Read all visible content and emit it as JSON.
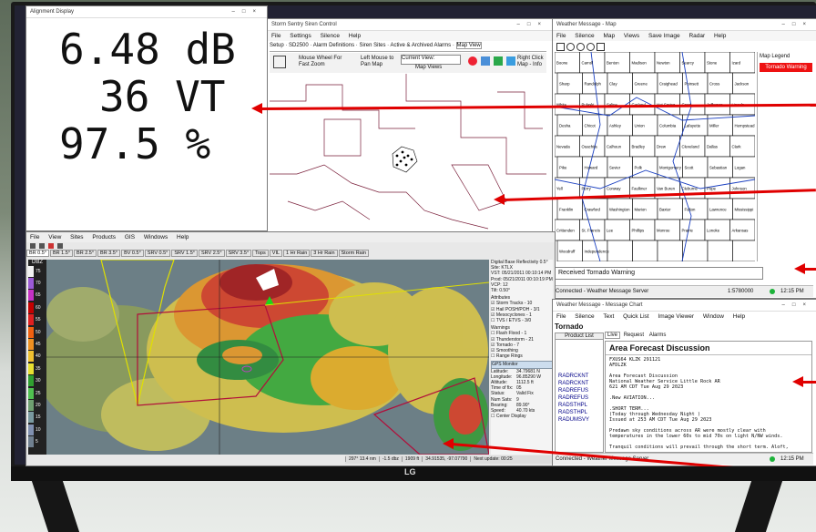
{
  "alignment": {
    "title": "Alignment Display",
    "line1": "6.48 dB",
    "line2": "36 VT",
    "line3": "97.5 %"
  },
  "siren": {
    "title": "Storm Sentry Siren Control",
    "menu": [
      "File",
      "Settings",
      "Silence",
      "Help"
    ],
    "tabs": [
      "Setup",
      "SD2500",
      "Alarm Definitions",
      "Siren Sites",
      "Active & Archived Alarms",
      "Map View"
    ],
    "mouse_wheel": "Mouse Wheel For Fast Zoom",
    "left_mouse": "Left Mouse to Pan Map",
    "view_value": "Current View:",
    "map_views": "Map Views",
    "right_click": "Right Click Map - Info"
  },
  "wxmap": {
    "title": "Weather Message - Map",
    "menu": [
      "File",
      "Silence",
      "Map",
      "Views",
      "Save Image",
      "Radar",
      "Help"
    ],
    "legend_title": "Map Legend",
    "legend_item": "Tornado Warning",
    "status_text": "Received Tornado Warning",
    "status_left": "Connected - Weather Message Server",
    "scale": "1:5780000",
    "time": "12:15 PM",
    "counties": [
      "Boone",
      "Carroll",
      "Benton",
      "Madison",
      "Newton",
      "Searcy",
      "Stone",
      "Izard",
      "Sharp",
      "Randolph",
      "Clay",
      "Greene",
      "Craighead",
      "Poinsett",
      "Cross",
      "Jackson",
      "White",
      "Pulaski",
      "Saline",
      "Garland",
      "Hot Spring",
      "Grant",
      "Jefferson",
      "Lincoln",
      "Desha",
      "Chicot",
      "Ashley",
      "Union",
      "Columbia",
      "Lafayette",
      "Miller",
      "Hempstead",
      "Nevada",
      "Ouachita",
      "Calhoun",
      "Bradley",
      "Drew",
      "Cleveland",
      "Dallas",
      "Clark",
      "Pike",
      "Howard",
      "Sevier",
      "Polk",
      "Montgomery",
      "Scott",
      "Sebastian",
      "Logan",
      "Yell",
      "Perry",
      "Conway",
      "Faulkner",
      "Van Buren",
      "Cleburne",
      "Pope",
      "Johnson",
      "Franklin",
      "Crawford",
      "Washington",
      "Marion",
      "Baxter",
      "Fulton",
      "Lawrence",
      "Mississippi",
      "Crittenden",
      "St. Francis",
      "Lee",
      "Phillips",
      "Monroe",
      "Prairie",
      "Lonoke",
      "Arkansas",
      "Woodruff",
      "Independence"
    ]
  },
  "radar": {
    "menu": [
      "File",
      "View",
      "Sites",
      "Products",
      "GIS",
      "Windows",
      "Help"
    ],
    "products": [
      "BR 0.5°",
      "BR 1.5°",
      "BR 2.5°",
      "BR 3.5°",
      "BV 0.5°",
      "SRV 0.5°",
      "SRV 1.5°",
      "SRV 2.5°",
      "SRV 3.5°",
      "Tops",
      "VIL",
      "1 Hr Rain",
      "3 Hr Rain",
      "Storm Rain"
    ],
    "scale_label": "DBZ",
    "scale": [
      "75",
      "70",
      "65",
      "60",
      "55",
      "50",
      "45",
      "40",
      "35",
      "30",
      "25",
      "20",
      "15",
      "10",
      "5"
    ],
    "info_title": "Digital Base Reflectivity 0.5°",
    "info_site": "Site: KTLX",
    "info_vst": "VST: 05/21/2011 00:10:14 PM",
    "info_prod": "Prod: 05/21/2011 00:10:19 PM",
    "info_vcp": "VCP: 12",
    "info_tilt": "Tilt: 0.50°",
    "attributes_title": "Attributes",
    "attributes": [
      "Storm Tracks - 10",
      "Hail POSH/POH - 3/1",
      "Mesocyclones - 1",
      "TVS / ETVS - 3/0"
    ],
    "warnings_title": "Warnings",
    "warnings": [
      "Flash Flood - 1",
      "Thunderstorm - 21",
      "Tornado - 7"
    ],
    "smoothing": "Smoothing",
    "range_rings": "Range Rings",
    "gps_title": "GPS Monitor",
    "gps_labels": [
      "Latitude:",
      "Longitude:",
      "Altitude:",
      "Time of fix:",
      "Status:",
      "Num Sats:",
      "Bearing:",
      "Speed:"
    ],
    "gps_values": [
      "34.79681 N",
      "96.85290 W",
      "1112.5 ft",
      "05",
      "Valid Fix",
      "9",
      "89.90°",
      "40.70 kts"
    ],
    "center_display": "Center Display",
    "status": [
      "297° 13.4 nm",
      "-1.5 dbz",
      "1909 ft",
      "34.91535, -97.07790",
      "Next update: 00:25"
    ]
  },
  "chart": {
    "title": "Weather Message - Message Chart",
    "menu": [
      "File",
      "Silence",
      "Text",
      "Quick List",
      "Image Viewer",
      "Window",
      "Help"
    ],
    "section": "Tornado",
    "product_list_hdr": "Product List",
    "tabs": [
      "Live",
      "Request",
      "Alarms"
    ],
    "products": [
      "RADRCKNT",
      "RADRCKNT",
      "RADREFUS",
      "RADREFUS",
      "RADSTHPL",
      "RADSTHPL",
      "RADUMSVY"
    ],
    "discussion_title": "Area Forecast Discussion",
    "body": "FXUS64 KLZK 291121\nAFDLZK\n\nArea Forecast Discussion\nNational Weather Service Little Rock AR\n621 AM CDT Tue Aug 29 2023\n\n.New AVIATION...\n\n.SHORT TERM...\n(Today through Wednesday Night )\nIssued at 253 AM CDT Tue Aug 29 2023\n\nPredawn sky conditions across AR were mostly clear with\ntemperatures in the lower 60s to mid 70s on light N/NW winds.\n\nTranquil conditions will prevail through the short term. Aloft,",
    "status_left": "Connected - Weather Message Server",
    "time": "12:15 PM"
  },
  "monitor_brand": "LG",
  "colors": {
    "arrow": "#e00000",
    "legend_red": "#ee1111",
    "radar_bg": "#5a6d7a"
  }
}
